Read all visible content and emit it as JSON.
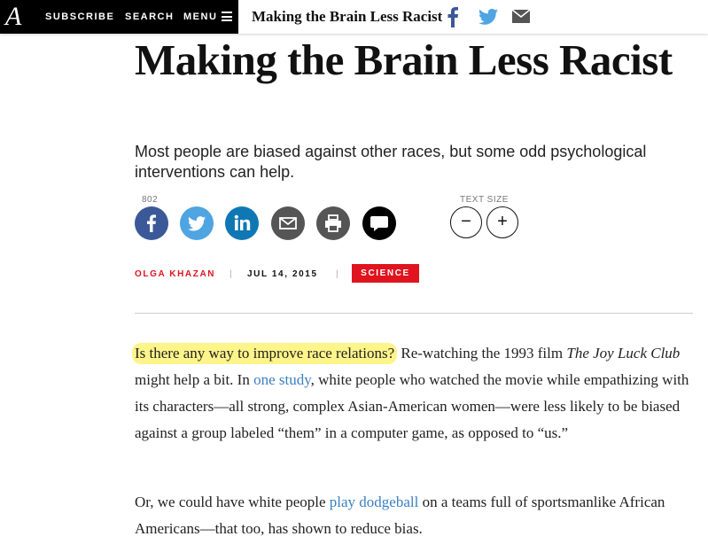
{
  "nav": {
    "logo": "A",
    "subscribe": "SUBSCRIBE",
    "search": "SEARCH",
    "menu": "MENU",
    "title": "Making the Brain Less Racist"
  },
  "article": {
    "headline": "Making the Brain Less Racist",
    "dek": "Most people are biased against other races, but some odd psychological interventions can help.",
    "share_count": "802",
    "text_size_label": "TEXT SIZE",
    "text_size_minus": "−",
    "text_size_plus": "+",
    "author": "OLGA KHAZAN",
    "separator": "|",
    "date": "JUL 14, 2015",
    "section": "SCIENCE"
  },
  "body": {
    "p1": {
      "highlight": "Is there any way to improve race relations?",
      "t1": " Re-watching the 1993 film ",
      "film": "The Joy Luck Club",
      "t2": " might help a bit. In ",
      "link": "one study",
      "t3": ", white people who watched the movie while empathizing with its characters—all strong, complex Asian-American women—were less likely to be biased against a group labeled “them” in a computer game, as opposed to “us.”"
    },
    "p2": {
      "t1": "Or, we could have white people ",
      "link": "play dodgeball",
      "t2": " on a teams full of sportsmanlike African Americans—that too, has shown to reduce bias."
    }
  },
  "colors": {
    "accent_red": "#e0141e",
    "link_blue": "#3a80c4",
    "highlight_yellow": "#fdf48a",
    "facebook": "#3b5998",
    "twitter": "#4fa4e2",
    "linkedin": "#0f78b4"
  },
  "icons": {
    "top_share": [
      "facebook-icon",
      "twitter-icon",
      "email-icon"
    ],
    "share_circles": [
      "facebook-icon",
      "twitter-icon",
      "linkedin-icon",
      "email-icon",
      "print-icon",
      "comment-icon"
    ]
  }
}
